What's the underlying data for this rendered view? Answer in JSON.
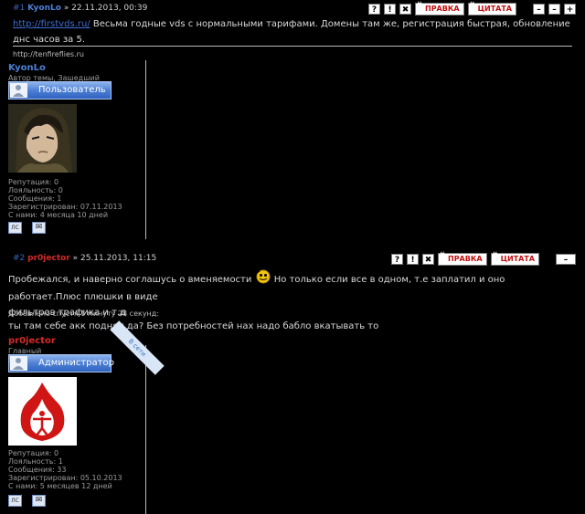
{
  "post1": {
    "num": "#1",
    "author": "KyonLo",
    "date": "» 22.11.2013, 00:39",
    "link": "http://firstvds.ru/",
    "text": " Весьма годные vds с нормальными тарифами. Домены там же, регистрация быстрая, обновление днс часов за 5.",
    "signature": "http://tenfireflies.ru",
    "user": {
      "name": "KyonLo",
      "subtitle": "Автор темы, Зашедший",
      "rank": "Пользователь",
      "stats": [
        "Репутация: 0",
        "Лояльность: 0",
        "Сообщения: 1",
        "Зарегистрирован: 07.11.2013",
        "С нами: 4 месяца 10 дней"
      ]
    }
  },
  "post2": {
    "num": "#2",
    "author": "pr0jector",
    "date": "» 25.11.2013, 11:15",
    "text_a": "Пробежался, и наверно соглашусь о вменяемости",
    "text_b": " Но только если все в одном, т.е заплатил и оно работает.Плюс плюшки в виде",
    "text_c": "фильтров трафика и т.д",
    "added": "Добавлено спустя 1 минуту 28 секунд:",
    "text2": "ты там себе акк поднял да? Без потребностей нах надо бабло вкатывать то",
    "user": {
      "name": "pr0jector",
      "subtitle": "Главный",
      "rank": "Администратор",
      "online": "В сети",
      "stats": [
        "Репутация: 0",
        "Лояльность: 1",
        "Сообщения: 33",
        "Зарегистрирован: 05.10.2013",
        "С нами: 5 месяцев 12 дней"
      ]
    }
  },
  "tools": {
    "edit": "ПРАВКА",
    "quote": "ЦИТАТА",
    "q": "?",
    "warn": "!",
    "del": "✖",
    "minus": "–",
    "plus": "+"
  },
  "icons": {
    "pm": "ЛС",
    "email": "✉"
  }
}
